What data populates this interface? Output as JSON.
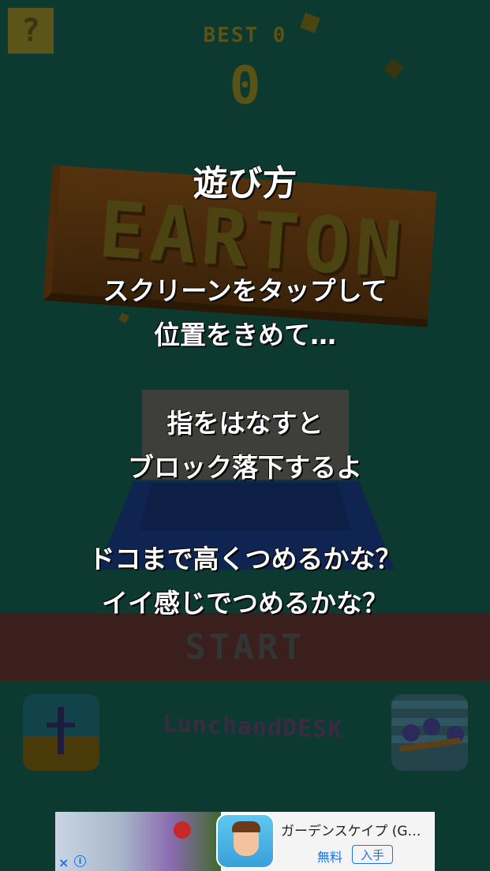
{
  "game": {
    "help_label": "?",
    "best_label": "BEST 0",
    "score": "0",
    "logo_text": "EARTON",
    "start_label": "START",
    "footer_logo_text": "LunchandDESK"
  },
  "overlay": {
    "title": "遊び方",
    "lines": [
      "スクリーンをタップして",
      "位置をきめて…",
      "指をはなすと",
      "ブロック落下するよ",
      "ドコまで高くつめるかな？",
      "イイ感じでつめるかな？"
    ]
  },
  "ad": {
    "title": "ガーデンスケイプ (G…",
    "price": "無料",
    "install_label": "入手",
    "close_icon": "×",
    "info_icon": "i"
  },
  "colors": {
    "background": "#0d3a30",
    "overlay_text": "#ffffff",
    "start_bar": "#3a1f1c",
    "ad_accent": "#1a73e8"
  }
}
